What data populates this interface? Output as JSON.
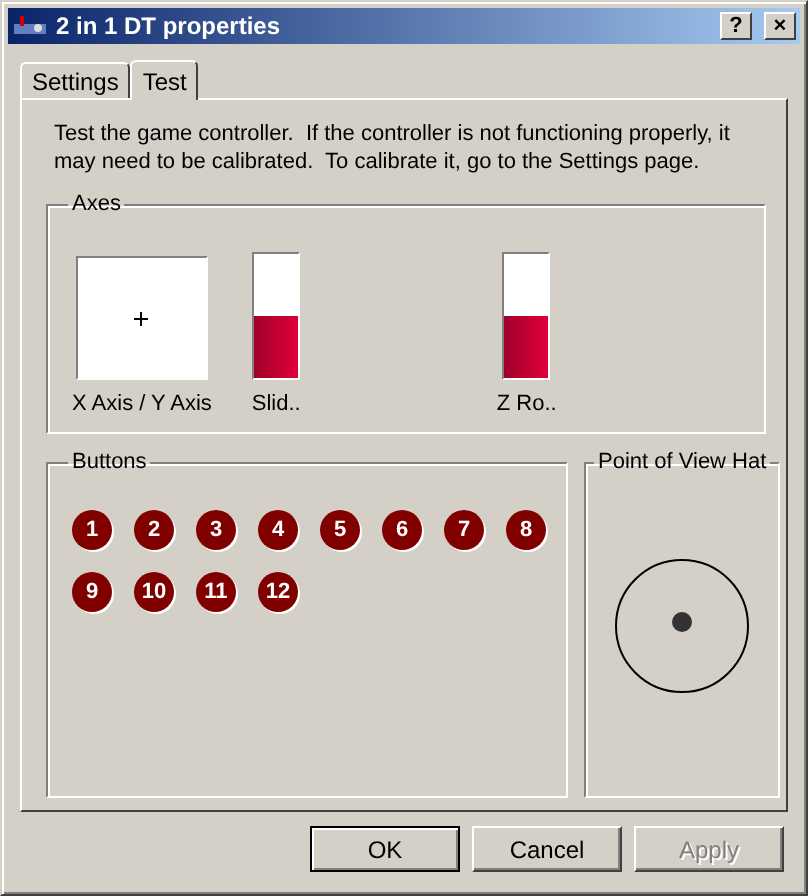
{
  "window": {
    "title": "2 in 1 DT properties",
    "help_button": "?",
    "close_button": "×"
  },
  "tabs": [
    {
      "label": "Settings",
      "selected": false
    },
    {
      "label": "Test",
      "selected": true
    }
  ],
  "description": "Test the game controller.  If the controller is not functioning properly, it may need to be calibrated.  To calibrate it, go to the Settings page.",
  "axes": {
    "title": "Axes",
    "items": [
      {
        "kind": "xy",
        "label": "X Axis / Y Axis"
      },
      {
        "kind": "bar",
        "label": "Slid..",
        "level": 0.5
      },
      {
        "kind": "bar",
        "label": "Z Ro..",
        "level": 0.5
      }
    ]
  },
  "buttons_group": {
    "title": "Buttons",
    "buttons": [
      "1",
      "2",
      "3",
      "4",
      "5",
      "6",
      "7",
      "8",
      "9",
      "10",
      "11",
      "12"
    ]
  },
  "pov_hat": {
    "title": "Point of View Hat"
  },
  "dialog_buttons": [
    {
      "label": "OK",
      "default": true,
      "disabled": false
    },
    {
      "label": "Cancel",
      "default": false,
      "disabled": false
    },
    {
      "label": "Apply",
      "default": false,
      "disabled": true
    }
  ]
}
